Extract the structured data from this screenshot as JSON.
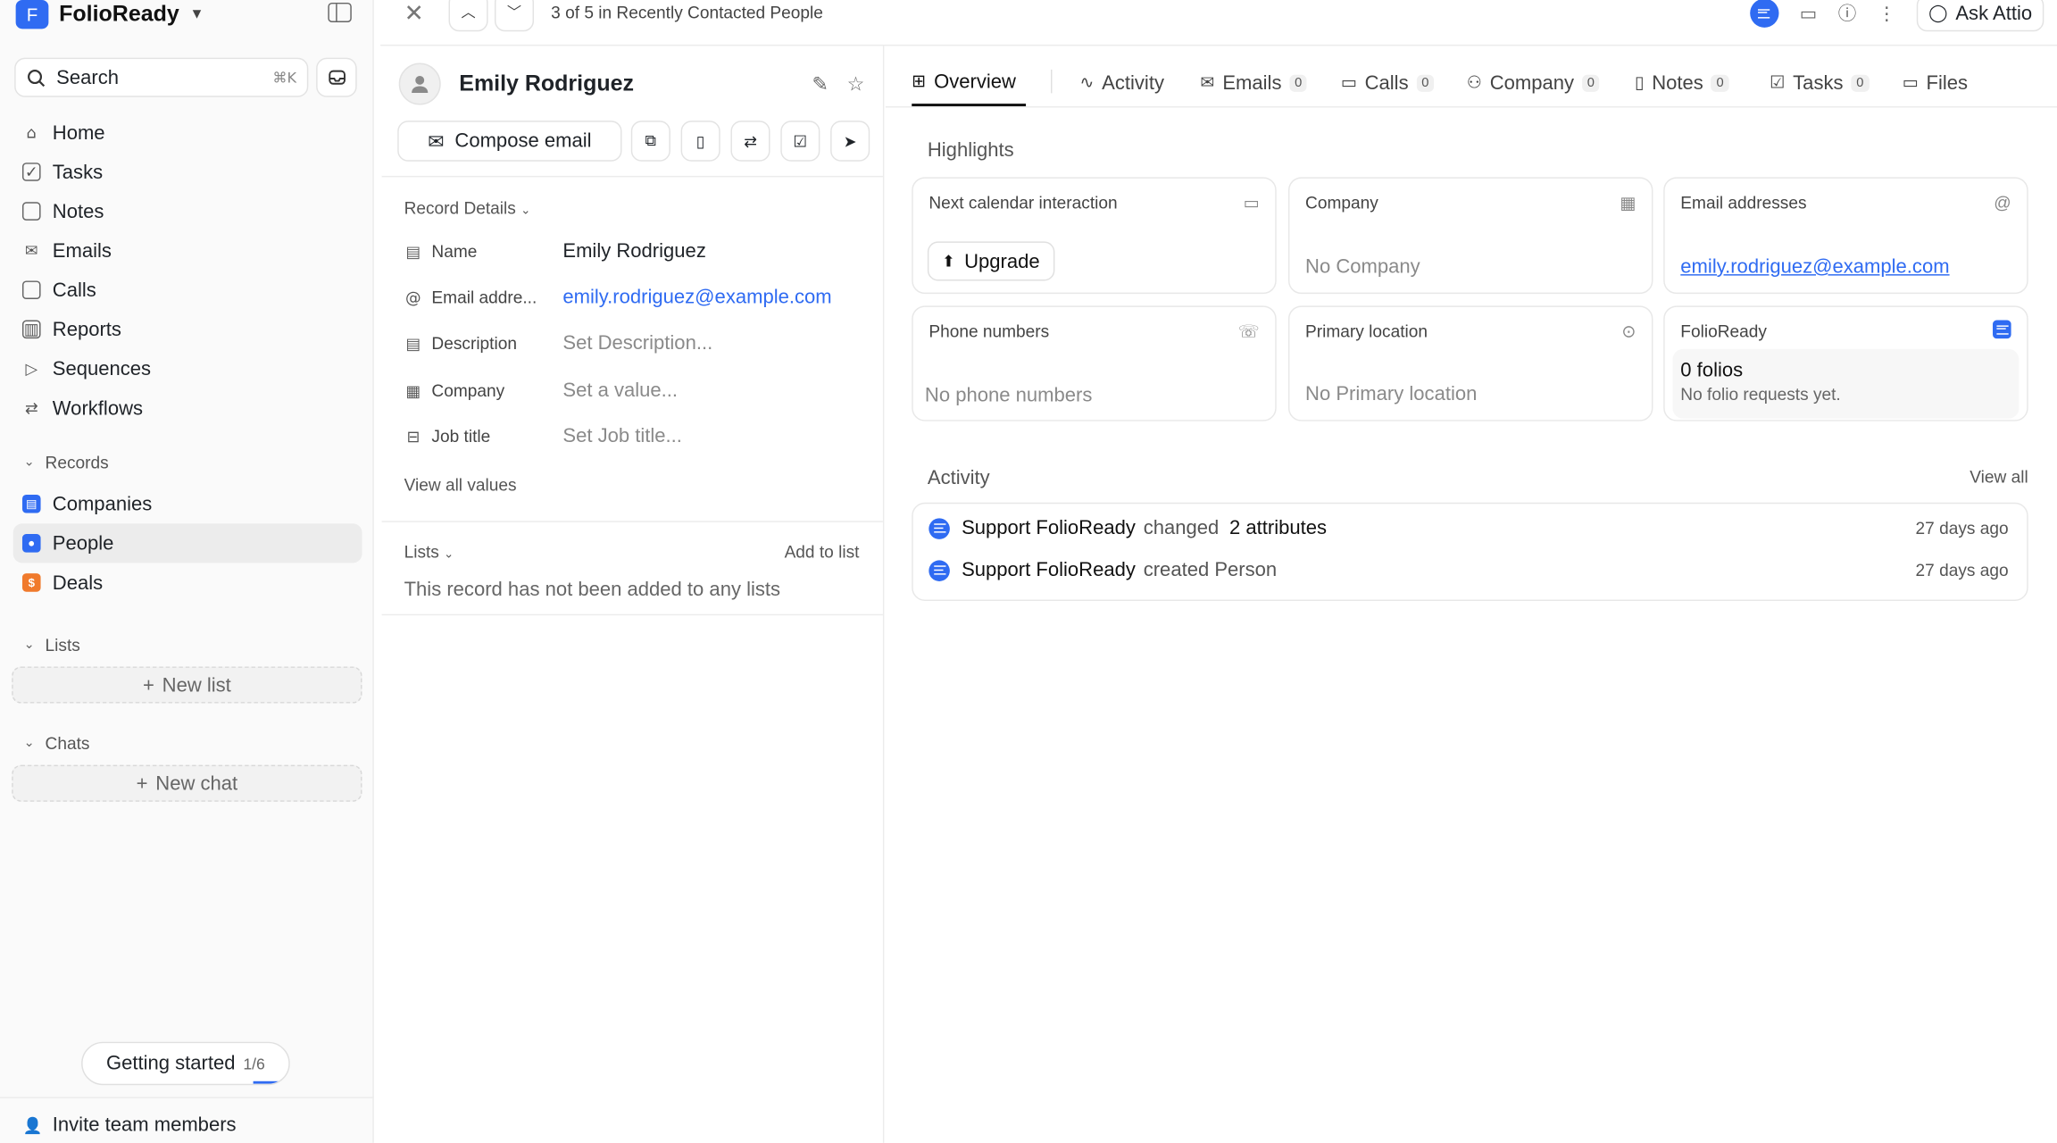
{
  "workspace": {
    "initial": "F",
    "name": "FolioReady"
  },
  "search": {
    "label": "Search",
    "shortcut": "⌘K"
  },
  "nav": [
    {
      "label": "Home",
      "icon": "home-icon"
    },
    {
      "label": "Tasks",
      "icon": "tasks-icon"
    },
    {
      "label": "Notes",
      "icon": "notes-icon"
    },
    {
      "label": "Emails",
      "icon": "emails-icon"
    },
    {
      "label": "Calls",
      "icon": "calls-icon"
    },
    {
      "label": "Reports",
      "icon": "reports-icon"
    },
    {
      "label": "Sequences",
      "icon": "sequences-icon"
    },
    {
      "label": "Workflows",
      "icon": "workflows-icon"
    }
  ],
  "records": {
    "heading": "Records",
    "items": [
      {
        "label": "Companies",
        "color": "#2f6bf2"
      },
      {
        "label": "People",
        "color": "#2f6bf2"
      },
      {
        "label": "Deals",
        "color": "#f07a2c"
      }
    ]
  },
  "lists": {
    "heading": "Lists",
    "new_label": "New list"
  },
  "chats": {
    "heading": "Chats",
    "new_label": "New chat"
  },
  "getting_started": {
    "label": "Getting started",
    "progress": "1/6"
  },
  "invite": {
    "label": "Invite team members"
  },
  "topbar": {
    "position": "3 of 5 in Recently Contacted People",
    "ask": "Ask Attio"
  },
  "record": {
    "name": "Emily Rodriguez",
    "compose": "Compose email",
    "details_title": "Record Details",
    "attributes": [
      {
        "label": "Name",
        "value": "Emily Rodriguez",
        "style": "normal"
      },
      {
        "label": "Email addre...",
        "value": "emily.rodriguez@example.com",
        "style": "link"
      },
      {
        "label": "Description",
        "value": "Set Description...",
        "style": "muted"
      },
      {
        "label": "Company",
        "value": "Set a value...",
        "style": "muted"
      },
      {
        "label": "Job title",
        "value": "Set Job title...",
        "style": "muted"
      }
    ],
    "view_all": "View all values",
    "lists_title": "Lists",
    "add_to_list": "Add to list",
    "no_lists": "This record has not been added to any lists"
  },
  "tabs": [
    {
      "label": "Overview",
      "count": null
    },
    {
      "label": "Activity",
      "count": null
    },
    {
      "label": "Emails",
      "count": "0"
    },
    {
      "label": "Calls",
      "count": "0"
    },
    {
      "label": "Company",
      "count": "0"
    },
    {
      "label": "Notes",
      "count": "0"
    },
    {
      "label": "Tasks",
      "count": "0"
    },
    {
      "label": "Files",
      "count": null
    }
  ],
  "highlights": {
    "title": "Highlights",
    "cards": [
      {
        "title": "Next calendar interaction",
        "button": "Upgrade"
      },
      {
        "title": "Company",
        "value": "No Company"
      },
      {
        "title": "Email addresses",
        "value": "emily.rodriguez@example.com"
      },
      {
        "title": "Phone numbers",
        "value": "No phone numbers"
      },
      {
        "title": "Primary location",
        "value": "No Primary location"
      },
      {
        "title": "FolioReady",
        "value": "0 folios",
        "sub": "No folio requests yet."
      }
    ]
  },
  "activity": {
    "title": "Activity",
    "view_all": "View all",
    "rows": [
      {
        "who": "Support FolioReady",
        "verb": "changed",
        "object": "2 attributes",
        "time": "27 days ago"
      },
      {
        "who": "Support FolioReady",
        "verb": "created Person",
        "object": "",
        "time": "27 days ago"
      }
    ]
  },
  "colors": {
    "accent": "#2f6bf2",
    "deals": "#f07a2c"
  }
}
